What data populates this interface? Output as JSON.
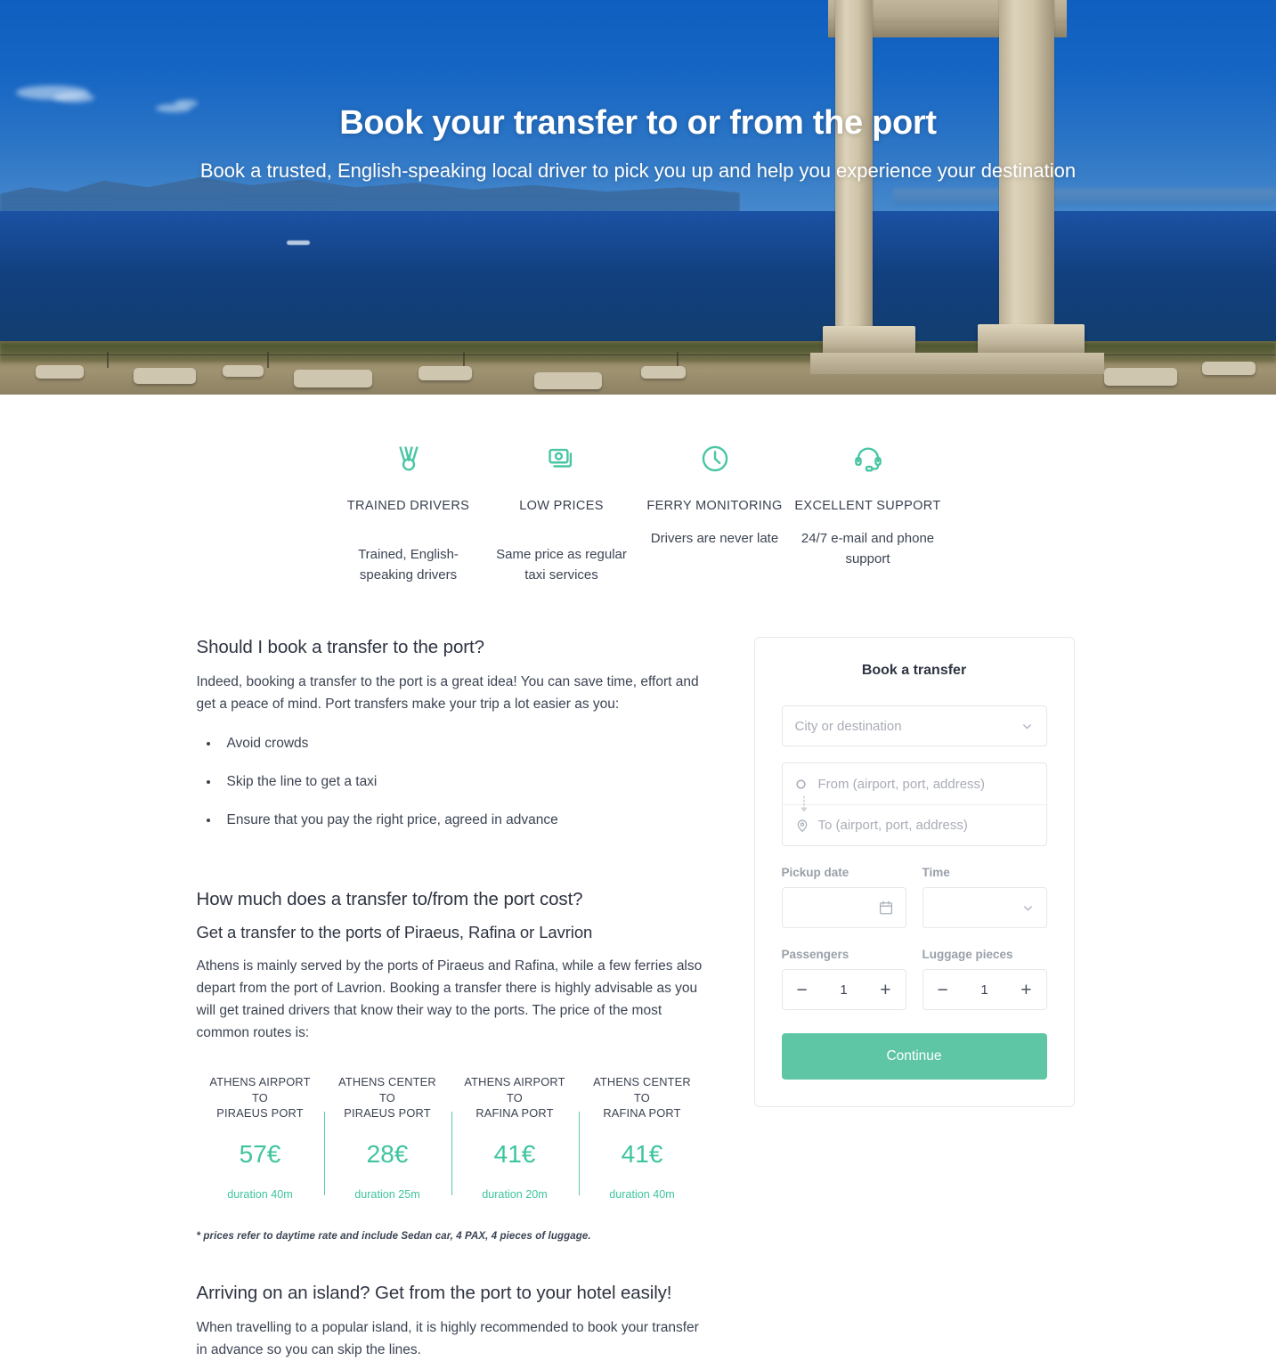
{
  "hero": {
    "title": "Book your transfer to or from the port",
    "subtitle": "Book a trusted, English-speaking local driver to pick you up and help you experience your destination"
  },
  "features": [
    {
      "icon": "medal-icon",
      "title": "TRAINED DRIVERS",
      "desc": "Trained, English-speaking drivers"
    },
    {
      "icon": "money-icon",
      "title": "LOW PRICES",
      "desc": "Same price as regular taxi services"
    },
    {
      "icon": "clock-icon",
      "title": "FERRY MONITORING",
      "desc": "Drivers are never late"
    },
    {
      "icon": "headset-icon",
      "title": "EXCELLENT SUPPORT",
      "desc": "24/7 e-mail and phone support"
    }
  ],
  "content": {
    "section1_heading": "Should I book a transfer to the port?",
    "section1_paragraph": "Indeed, booking a transfer to the port is a great idea! You can save time, effort and get a peace of mind. Port transfers make your trip a lot easier as you:",
    "bullets": [
      "Avoid crowds",
      "Skip the line to get a taxi",
      "Ensure that you pay the right price, agreed in advance"
    ],
    "section2_heading": "How much does a transfer to/from the port cost?",
    "section2_subheading": "Get a transfer to the ports of Piraeus, Rafina or Lavrion",
    "section2_paragraph": "Athens is mainly served by the ports of Piraeus and Rafina, while a few ferries also depart from the port of Lavrion. Booking a transfer there is highly advisable as you will get trained drivers that know their way to the ports. The price of the most common routes is:",
    "footnote": "* prices refer to daytime rate and include Sedan car, 4 PAX, 4 pieces of luggage.",
    "section3_heading": "Arriving on an island? Get from the port to your hotel easily!",
    "section3_paragraph": "When travelling to a popular island, it is highly recommended to book your transfer in advance so you can skip the lines."
  },
  "prices": [
    {
      "from": "ATHENS AIRPORT",
      "connector": "TO",
      "to": "PIRAEUS PORT",
      "price": "57€",
      "duration": "duration 40m"
    },
    {
      "from": "ATHENS CENTER",
      "connector": "TO",
      "to": "PIRAEUS PORT",
      "price": "28€",
      "duration": "duration 25m"
    },
    {
      "from": "ATHENS AIRPORT",
      "connector": "TO",
      "to": "RAFINA PORT",
      "price": "41€",
      "duration": "duration 20m"
    },
    {
      "from": "ATHENS CENTER",
      "connector": "TO",
      "to": "RAFINA PORT",
      "price": "41€",
      "duration": "duration 40m"
    }
  ],
  "booking": {
    "title": "Book a transfer",
    "city_placeholder": "City or destination",
    "from_placeholder": "From (airport, port, address)",
    "to_placeholder": "To (airport, port, address)",
    "pickup_date_label": "Pickup date",
    "pickup_date_value": "",
    "time_label": "Time",
    "time_value": "",
    "passengers_label": "Passengers",
    "passengers_value": "1",
    "luggage_label": "Luggage pieces",
    "luggage_value": "1",
    "minus": "−",
    "plus": "+",
    "cta_label": "Continue"
  },
  "colors": {
    "accent_teal": "#3ec49f",
    "cta_teal": "#5ec5a5",
    "text_dark": "#2e3442",
    "text_muted": "#9aa0aa",
    "placeholder": "#a9adb6",
    "hero_blue": "#1565c4"
  }
}
